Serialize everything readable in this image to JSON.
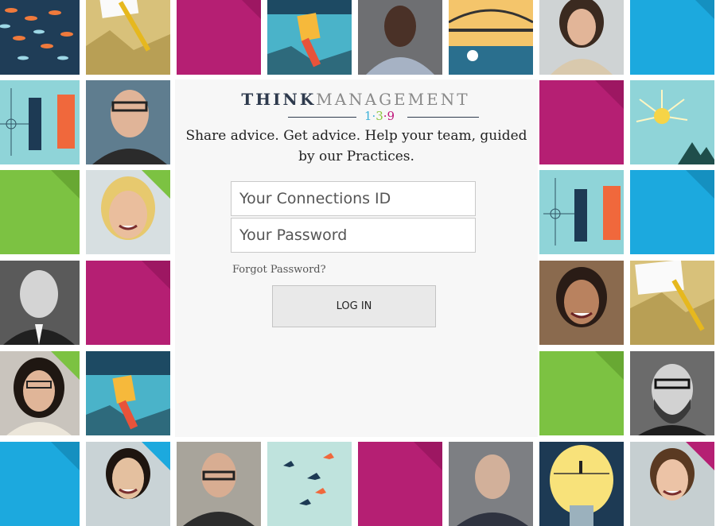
{
  "brand": {
    "word_think": "THINK",
    "word_management": "MANAGEMENT",
    "digit_one": "1",
    "digit_three": "3",
    "digit_nine": "9",
    "dot": "·",
    "color_think": "#2e3a4d",
    "color_management": "#8a8a8a",
    "color_one": "#3db1d8",
    "color_three": "#8dc63f",
    "color_nine": "#c0177b"
  },
  "tagline": "Share advice. Get advice. Help your team, guided by our Practices.",
  "login": {
    "id_placeholder": "Your Connections ID",
    "password_placeholder": "Your Password",
    "forgot_label": "Forgot Password?",
    "login_label": "LOG IN"
  },
  "palette": {
    "magenta": "#b51f73",
    "green": "#7cc242",
    "blue": "#1ca9de",
    "teal": "#8fd4d8",
    "navy": "#1d3a54",
    "orange": "#f0683c",
    "gold": "#d8c17a"
  },
  "mosaic_tiles": [
    {
      "name": "tile-photo-fish-school",
      "kind": "fish"
    },
    {
      "name": "tile-photo-paper-pencil",
      "kind": "paper"
    },
    {
      "name": "tile-color-block",
      "kind": "magenta"
    },
    {
      "name": "tile-photo-paintbrush",
      "kind": "brush"
    },
    {
      "name": "tile-photo-man-portrait",
      "kind": "portrait"
    },
    {
      "name": "tile-photo-bridge-illustration",
      "kind": "bridge"
    },
    {
      "name": "tile-photo-woman-portrait",
      "kind": "portrait"
    },
    {
      "name": "tile-color-block",
      "kind": "blue"
    },
    {
      "name": "tile-photo-blueprint",
      "kind": "blueprint"
    },
    {
      "name": "tile-photo-man-glasses-portrait",
      "kind": "portrait"
    },
    {
      "name": "tile-color-block",
      "kind": "magenta"
    },
    {
      "name": "tile-photo-lightbulb-burst",
      "kind": "burst"
    },
    {
      "name": "tile-color-block",
      "kind": "green"
    },
    {
      "name": "tile-photo-woman-smiling-portrait",
      "kind": "portrait"
    },
    {
      "name": "tile-photo-blueprint",
      "kind": "blueprint"
    },
    {
      "name": "tile-color-block",
      "kind": "blue"
    },
    {
      "name": "tile-photo-man-bw-portrait",
      "kind": "portrait"
    },
    {
      "name": "tile-color-block",
      "kind": "magenta"
    },
    {
      "name": "tile-photo-woman-portrait",
      "kind": "portrait"
    },
    {
      "name": "tile-photo-paper-pencil",
      "kind": "paper"
    },
    {
      "name": "tile-photo-woman-glasses-portrait",
      "kind": "portrait"
    },
    {
      "name": "tile-photo-paintbrush",
      "kind": "brush"
    },
    {
      "name": "tile-color-block",
      "kind": "green"
    },
    {
      "name": "tile-photo-man-bearded-portrait",
      "kind": "portrait"
    },
    {
      "name": "tile-color-block",
      "kind": "blue"
    },
    {
      "name": "tile-photo-woman-portrait",
      "kind": "portrait"
    },
    {
      "name": "tile-photo-man-glasses-portrait",
      "kind": "portrait"
    },
    {
      "name": "tile-photo-birds-flying",
      "kind": "birds"
    },
    {
      "name": "tile-color-block",
      "kind": "magenta"
    },
    {
      "name": "tile-photo-man-portrait",
      "kind": "portrait"
    },
    {
      "name": "tile-photo-lightbulb-tightrope",
      "kind": "bulb"
    },
    {
      "name": "tile-photo-woman-portrait",
      "kind": "portrait"
    }
  ]
}
